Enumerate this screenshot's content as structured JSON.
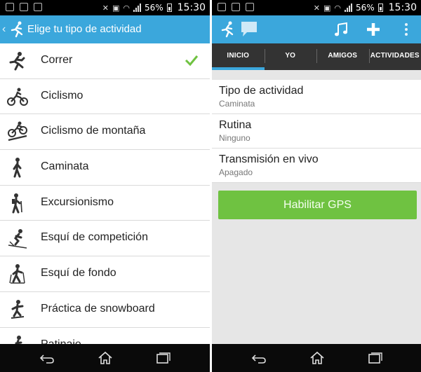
{
  "status_bar": {
    "battery_percent": "56%",
    "time": "15:30",
    "signal_tag": "4G"
  },
  "left_screen": {
    "app_bar": {
      "title": "Elige tu tipo de actividad"
    },
    "activities": [
      {
        "label": "Correr",
        "icon": "runner-icon",
        "selected": true
      },
      {
        "label": "Ciclismo",
        "icon": "cyclist-icon",
        "selected": false
      },
      {
        "label": "Ciclismo de montaña",
        "icon": "mountain-bike-icon",
        "selected": false
      },
      {
        "label": "Caminata",
        "icon": "walker-icon",
        "selected": false
      },
      {
        "label": "Excursionismo",
        "icon": "hiker-icon",
        "selected": false
      },
      {
        "label": "Esquí de competición",
        "icon": "downhill-ski-icon",
        "selected": false
      },
      {
        "label": "Esquí de fondo",
        "icon": "cross-country-ski-icon",
        "selected": false
      },
      {
        "label": "Práctica de snowboard",
        "icon": "snowboard-icon",
        "selected": false
      },
      {
        "label": "Patinaje",
        "icon": "skating-icon",
        "selected": false
      }
    ],
    "accent_color": "#3ba7dc",
    "check_color": "#6fc241"
  },
  "right_screen": {
    "tabs": [
      {
        "label": "INICIO",
        "active": true
      },
      {
        "label": "YO",
        "active": false
      },
      {
        "label": "AMIGOS",
        "active": false
      },
      {
        "label": "ACTIVIDADES",
        "active": false
      }
    ],
    "settings": [
      {
        "title": "Tipo de actividad",
        "value": "Caminata"
      },
      {
        "title": "Rutina",
        "value": "Ninguno"
      },
      {
        "title": "Transmisión en vivo",
        "value": "Apagado"
      }
    ],
    "gps_button": "Habilitar GPS",
    "gps_color": "#6fc241"
  }
}
